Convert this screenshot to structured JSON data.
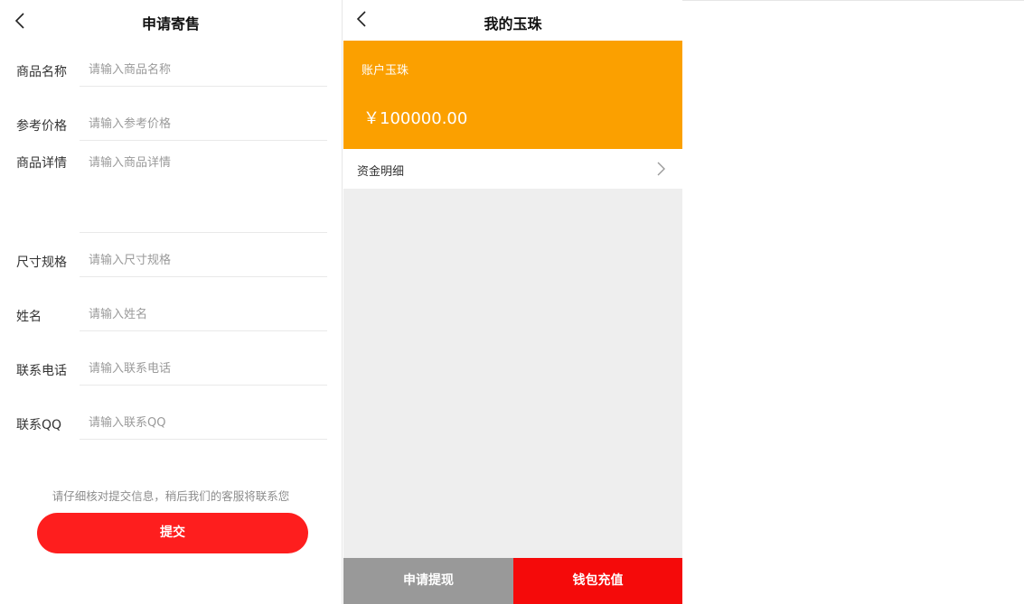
{
  "consign": {
    "title": "申请寄售",
    "fields": [
      {
        "label": "商品名称",
        "placeholder": "请输入商品名称"
      },
      {
        "label": "参考价格",
        "placeholder": "请输入参考价格"
      },
      {
        "label": "商品详情",
        "placeholder": "请输入商品详情"
      },
      {
        "label": "尺寸规格",
        "placeholder": "请输入尺寸规格"
      },
      {
        "label": "姓名",
        "placeholder": "请输入姓名"
      },
      {
        "label": "联系电话",
        "placeholder": "请输入联系电话"
      },
      {
        "label": "联系QQ",
        "placeholder": "请输入联系QQ"
      }
    ],
    "notice": "请仔细核对提交信息，稍后我们的客服将联系您",
    "submit_label": "提交"
  },
  "wallet": {
    "title": "我的玉珠",
    "account_label": "账户玉珠",
    "balance": "￥100000.00",
    "detail_label": "资金明细",
    "withdraw_label": "申请提现",
    "recharge_label": "钱包充值"
  },
  "colors": {
    "accent_orange": "#fba000",
    "submit_red": "#fe1e1e",
    "recharge_red": "#f50a0a",
    "withdraw_gray": "#999999"
  },
  "icons": {
    "back": "chevron-left-icon",
    "detail": "chevron-right-icon"
  }
}
